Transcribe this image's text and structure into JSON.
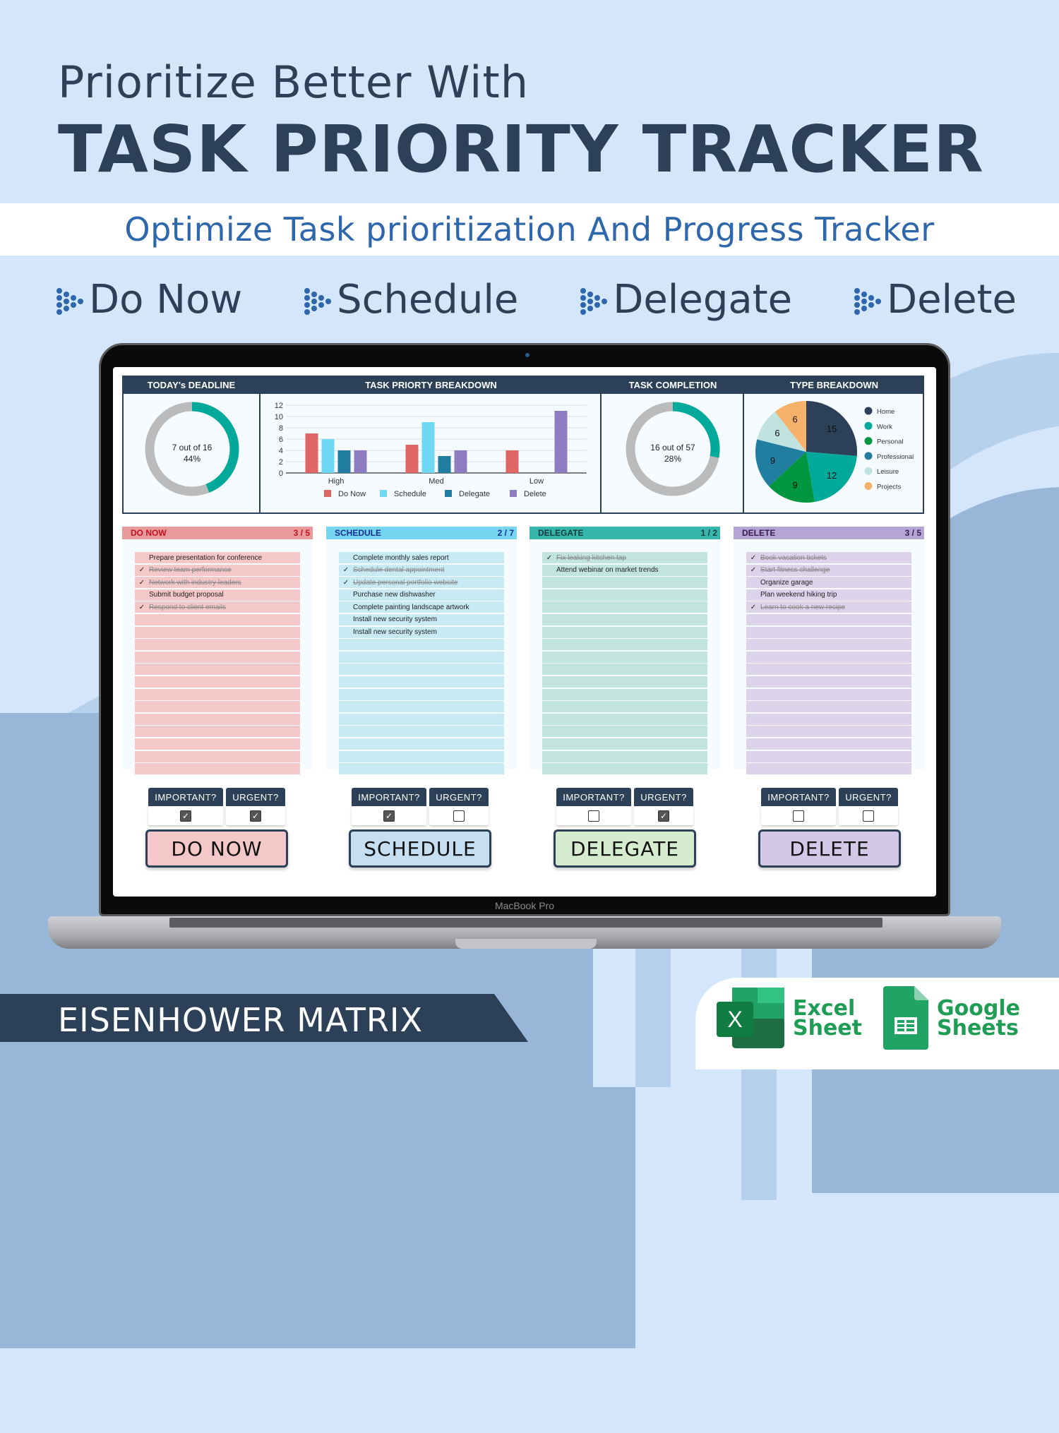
{
  "hero": {
    "line1": "Prioritize Better With",
    "line2": "TASK PRIORITY TRACKER",
    "subtitle": "Optimize Task prioritization And Progress Tracker",
    "categories": [
      "Do Now",
      "Schedule",
      "Delegate",
      "Delete"
    ]
  },
  "laptop": {
    "brand": "MacBook Pro"
  },
  "dashboard": {
    "headers": [
      "TODAY's DEADLINE",
      "TASK PRIORTY BREAKDOWN",
      "TASK COMPLETION",
      "TYPE BREAKDOWN"
    ],
    "todays_deadline": {
      "line1": "7 out of 16",
      "line2": "44%",
      "fraction": 0.44
    },
    "task_completion": {
      "line1": "16 out of 57",
      "line2": "28%",
      "fraction": 0.28
    },
    "colors": {
      "teal": "#00a99a",
      "gray": "#bbbbbb",
      "navy": "#2c4058"
    }
  },
  "chart_data": [
    {
      "type": "bar",
      "title": "TASK PRIORTY BREAKDOWN",
      "categories": [
        "High",
        "Med",
        "Low"
      ],
      "series": [
        {
          "name": "Do Now",
          "color": "#e06666",
          "values": [
            7,
            5,
            4
          ]
        },
        {
          "name": "Schedule",
          "color": "#6fd8f5",
          "values": [
            6,
            9,
            0
          ]
        },
        {
          "name": "Delegate",
          "color": "#217ea0",
          "values": [
            4,
            3,
            0
          ]
        },
        {
          "name": "Delete",
          "color": "#8e7cc3",
          "values": [
            4,
            4,
            11
          ]
        }
      ],
      "yticks": [
        0,
        2,
        4,
        6,
        8,
        10,
        12
      ],
      "ylim": [
        0,
        12
      ],
      "legend": "bottom",
      "grid": true
    },
    {
      "type": "pie",
      "title": "TYPE BREAKDOWN",
      "slices": [
        {
          "label": "Home",
          "value": 15,
          "color": "#2c4058"
        },
        {
          "label": "Work",
          "value": 12,
          "color": "#00a99a"
        },
        {
          "label": "Personal",
          "value": 9,
          "color": "#00963f"
        },
        {
          "label": "Professional",
          "value": 9,
          "color": "#217ea0"
        },
        {
          "label": "Leisure",
          "value": 6,
          "color": "#c0e3e0"
        },
        {
          "label": "Projects",
          "value": 6,
          "color": "#f6b26b"
        }
      ],
      "legend": "right"
    }
  ],
  "lists": [
    {
      "title": "DO NOW",
      "count": "3 / 5",
      "head_bg": "#e99a9c",
      "head_color": "#c0121f",
      "row_bg": "#f4c7c8",
      "items": [
        {
          "text": "Prepare presentation for conference",
          "done": false
        },
        {
          "text": "Review team performance",
          "done": true
        },
        {
          "text": "Network with industry leaders",
          "done": true
        },
        {
          "text": "Submit budget proposal",
          "done": false
        },
        {
          "text": "Respond to client emails",
          "done": true
        }
      ]
    },
    {
      "title": "SCHEDULE",
      "count": "2 / 7",
      "head_bg": "#76d6f2",
      "head_color": "#17308e",
      "row_bg": "#c8eaf3",
      "items": [
        {
          "text": "Complete monthly sales report",
          "done": false
        },
        {
          "text": "Schedule dental appointment",
          "done": true
        },
        {
          "text": "Update personal portfolio website",
          "done": true
        },
        {
          "text": "Purchase new dishwasher",
          "done": false
        },
        {
          "text": "Complete painting landscape artwork",
          "done": false
        },
        {
          "text": "Install new security system",
          "done": false
        },
        {
          "text": "Install new security system",
          "done": false
        }
      ]
    },
    {
      "title": "DELEGATE",
      "count": "1 / 2",
      "head_bg": "#36b7ad",
      "head_color": "#123a3a",
      "row_bg": "#c2e4df",
      "items": [
        {
          "text": "Fix leaking kitchen tap",
          "done": true
        },
        {
          "text": "Attend webinar on market trends",
          "done": false
        }
      ]
    },
    {
      "title": "DELETE",
      "count": "3 / 5",
      "head_bg": "#b4a5d5",
      "head_color": "#3a1c52",
      "row_bg": "#dcd2ea",
      "items": [
        {
          "text": "Book vacation tickets",
          "done": true
        },
        {
          "text": "Start fitness challenge",
          "done": true
        },
        {
          "text": "Organize garage",
          "done": false
        },
        {
          "text": "Plan weekend hiking trip",
          "done": false
        },
        {
          "text": "Learn to cook a new recipe",
          "done": true
        }
      ]
    }
  ],
  "controls": [
    {
      "important_label": "IMPORTANT?",
      "urgent_label": "URGENT?",
      "important": true,
      "urgent": true,
      "result": "DO NOW",
      "color": "#f4c7c8"
    },
    {
      "important_label": "IMPORTANT?",
      "urgent_label": "URGENT?",
      "important": true,
      "urgent": false,
      "result": "SCHEDULE",
      "color": "#c6def2"
    },
    {
      "important_label": "IMPORTANT?",
      "urgent_label": "URGENT?",
      "important": false,
      "urgent": true,
      "result": "DELEGATE",
      "color": "#d5ecce"
    },
    {
      "important_label": "IMPORTANT?",
      "urgent_label": "URGENT?",
      "important": false,
      "urgent": false,
      "result": "DELETE",
      "color": "#d3c8e8"
    }
  ],
  "footer": {
    "banner": "EISENHOWER MATRIX",
    "excel": [
      "Excel",
      "Sheet"
    ],
    "google": [
      "Google",
      "Sheets"
    ]
  }
}
